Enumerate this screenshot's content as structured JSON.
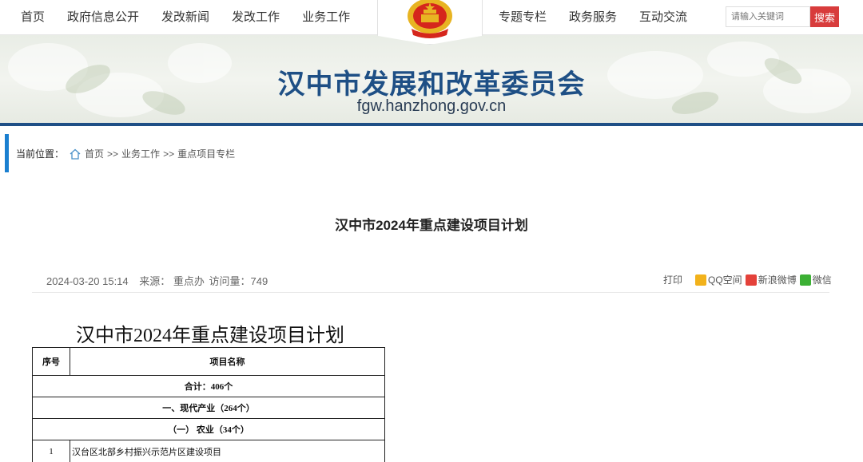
{
  "nav": {
    "left": [
      "首页",
      "政府信息公开",
      "发改新闻",
      "发改工作",
      "业务工作"
    ],
    "right": [
      "专题专栏",
      "政务服务",
      "互动交流"
    ]
  },
  "search": {
    "placeholder": "请输入关键词",
    "button": "搜索"
  },
  "banner": {
    "title": "汉中市发展和改革委员会",
    "domain": "fgw.hanzhong.gov.cn"
  },
  "breadcrumb": {
    "label": "当前位置：",
    "items": [
      "首页",
      "业务工作",
      "重点项目专栏"
    ],
    "separator": ">>"
  },
  "article": {
    "title": "汉中市2024年重点建设项目计划",
    "date": "2024-03-20 15:14",
    "source": "来源： 重点办",
    "visits": "访问量：749"
  },
  "share": {
    "print": "打印",
    "qq": "QQ空间",
    "weibo": "新浪微博",
    "wechat": "微信"
  },
  "doc": {
    "title": "汉中市2024年重点建设项目计划",
    "headers": [
      "序号",
      "项目名称"
    ],
    "rows": [
      "合计：406个",
      "一、现代产业（264个）",
      "（一）  农业（34个）"
    ],
    "data_rows": [
      {
        "num": "1",
        "name": "汉台区北部乡村振兴示范片区建设项目"
      }
    ]
  },
  "colors": {
    "brand_blue": "#1e4f85",
    "search_red": "#d83c3c",
    "accent_blue": "#1a7fd0"
  }
}
